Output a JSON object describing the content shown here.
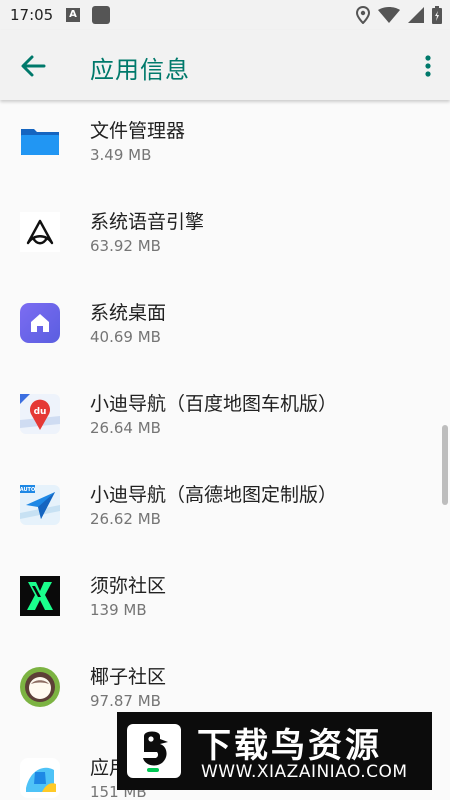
{
  "status_bar": {
    "time": "17:05",
    "left_icons": [
      "text-a-icon",
      "notification-square-icon"
    ],
    "right_icons": [
      "location-icon",
      "wifi-icon",
      "signal-icon",
      "battery-icon"
    ]
  },
  "app_bar": {
    "title": "应用信息",
    "accent_color": "#00796b",
    "back_icon": "arrow-back-icon",
    "menu_icon": "more-vert-icon"
  },
  "apps": [
    {
      "name": "文件管理器",
      "size": "3.49 MB",
      "icon": "folder-icon"
    },
    {
      "name": "系统语音引擎",
      "size": "63.92 MB",
      "icon": "voice-engine-icon"
    },
    {
      "name": "系统桌面",
      "size": "40.69 MB",
      "icon": "home-launcher-icon"
    },
    {
      "name": "小迪导航（百度地图车机版）",
      "size": "26.64 MB",
      "icon": "baidu-map-icon"
    },
    {
      "name": "小迪导航（高德地图定制版）",
      "size": "26.62 MB",
      "icon": "amap-auto-icon"
    },
    {
      "name": "须弥社区",
      "size": "139 MB",
      "icon": "xumi-community-icon"
    },
    {
      "name": "椰子社区",
      "size": "97.87 MB",
      "icon": "coconut-community-icon"
    },
    {
      "name": "应用",
      "size": "151 MB",
      "icon": "app-store-icon"
    }
  ],
  "watermark": {
    "title": "下载鸟资源",
    "url": "WWW.XIAZAINIAO.COM"
  }
}
